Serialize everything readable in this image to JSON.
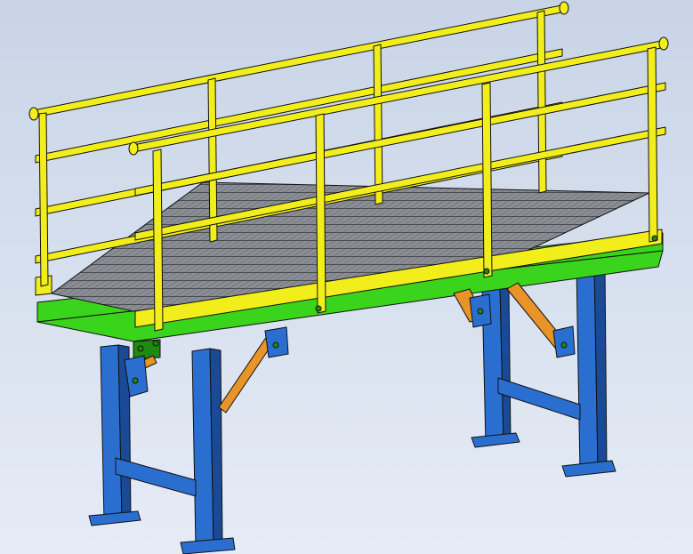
{
  "scene": {
    "subject": "platform-with-handrails",
    "palette": {
      "background_top": "#c8d4e6",
      "background_bottom": "#e6ecf6",
      "handrail": "#f2ee1c",
      "handrail_dark": "#b8b000",
      "frame": "#3bd41c",
      "frame_dark": "#1f8a10",
      "grating": "#8a8e94",
      "grating_line": "#3a3c40",
      "legs": "#2a6fd0",
      "legs_dark": "#1a4a96",
      "braces": "#e89428",
      "braces_dark": "#a25e10",
      "outline": "#111111"
    }
  }
}
